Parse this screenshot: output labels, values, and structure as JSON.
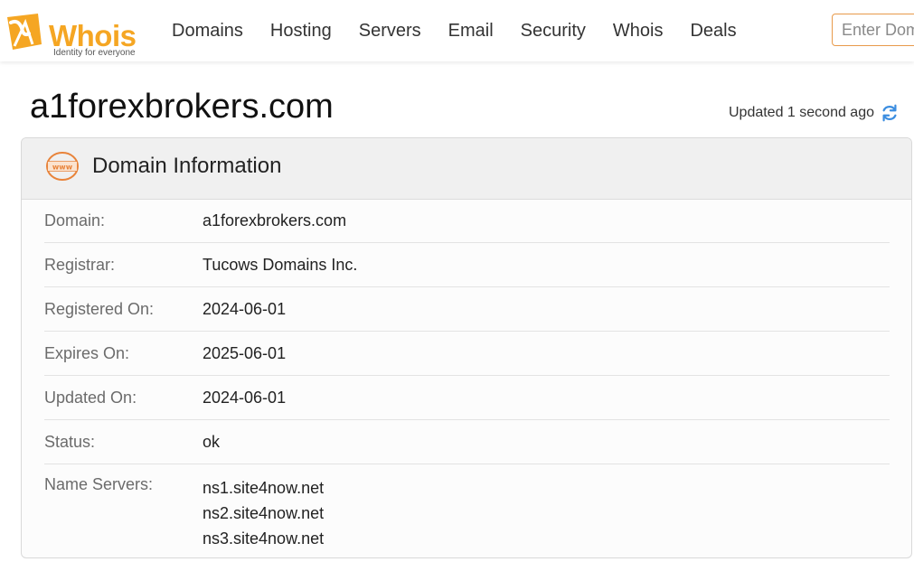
{
  "header": {
    "logo_text": "Whois",
    "logo_tagline": "Identity for everyone",
    "nav": [
      "Domains",
      "Hosting",
      "Servers",
      "Email",
      "Security",
      "Whois",
      "Deals"
    ],
    "search_placeholder": "Enter Domain"
  },
  "page": {
    "title": "a1forexbrokers.com",
    "updated": "Updated 1 second ago"
  },
  "card": {
    "title": "Domain Information",
    "rows": [
      {
        "label": "Domain:",
        "value": "a1forexbrokers.com"
      },
      {
        "label": "Registrar:",
        "value": "Tucows Domains Inc."
      },
      {
        "label": "Registered On:",
        "value": "2024-06-01"
      },
      {
        "label": "Expires On:",
        "value": "2025-06-01"
      },
      {
        "label": "Updated On:",
        "value": "2024-06-01"
      },
      {
        "label": "Status:",
        "value": "ok"
      }
    ],
    "name_servers_label": "Name Servers:",
    "name_servers": [
      "ns1.site4now.net",
      "ns2.site4now.net",
      "ns3.site4now.net"
    ]
  },
  "colors": {
    "brand": "#f5a623",
    "accent_orange": "#e8833a",
    "refresh_blue": "#3b8de0"
  },
  "icons": [
    "whois-logo-icon",
    "refresh-icon",
    "www-globe-icon"
  ]
}
